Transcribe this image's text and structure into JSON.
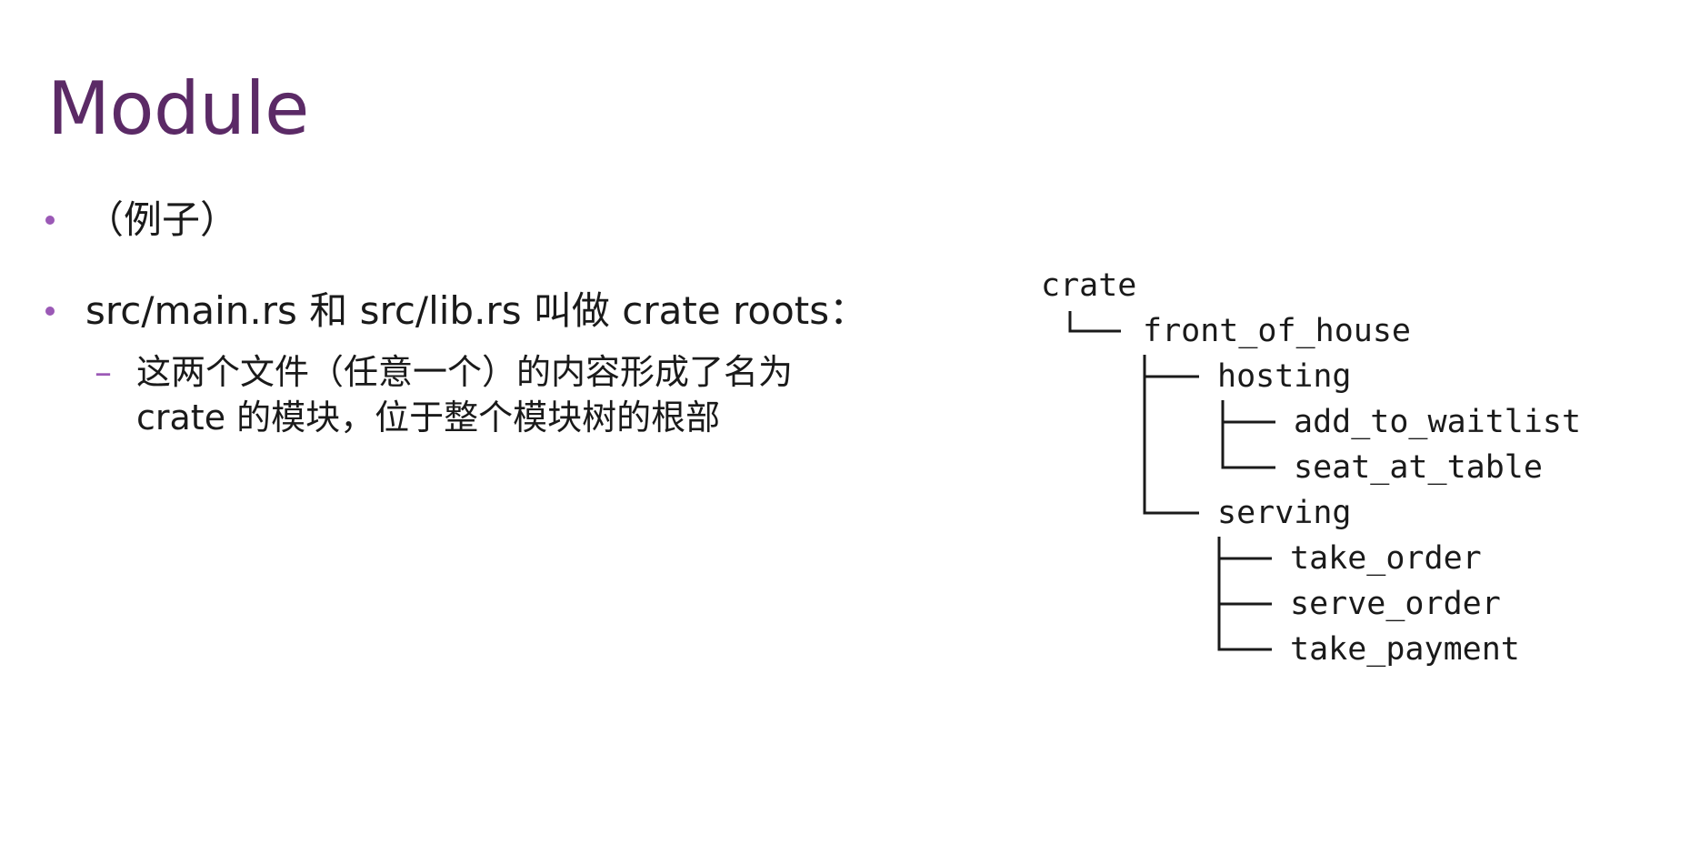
{
  "slide": {
    "title": "Module",
    "bullets": [
      {
        "text": "（例子）"
      },
      {
        "text": "src/main.rs 和 src/lib.rs 叫做 crate roots："
      }
    ],
    "sub_bullet": {
      "dash": "–",
      "lines": [
        "这两个文件（任意一个）的内容形成了名为",
        "crate 的模块，位于整个模块树的根部"
      ]
    }
  },
  "tree": {
    "root": "crate",
    "front_of_house": "front_of_house",
    "hosting": "hosting",
    "add_to_waitlist": "add_to_waitlist",
    "seat_at_table": "seat_at_table",
    "serving": "serving",
    "take_order": "take_order",
    "serve_order": "serve_order",
    "take_payment": "take_payment"
  },
  "colors": {
    "title": "#5b2a66",
    "bullet_accent": "#9b59b6",
    "text": "#1a1a1a",
    "background": "#ffffff"
  }
}
